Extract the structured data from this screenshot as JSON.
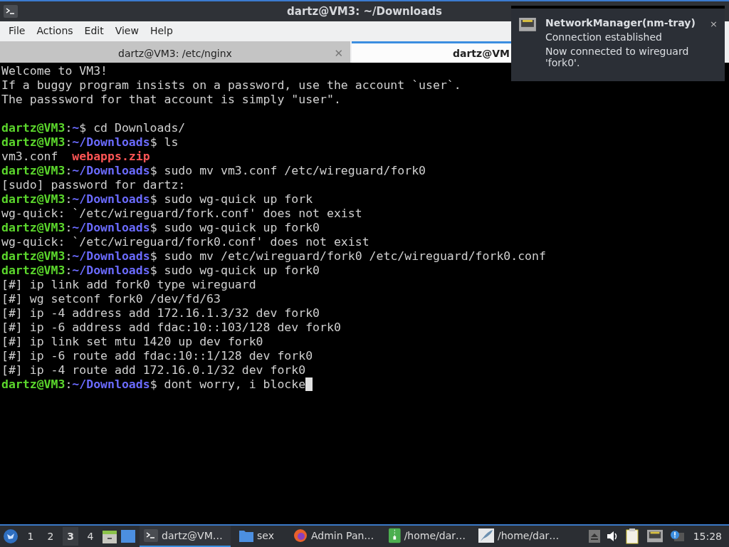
{
  "window": {
    "title": "dartz@VM3: ~/Downloads"
  },
  "menu": [
    "File",
    "Actions",
    "Edit",
    "View",
    "Help"
  ],
  "tabs": [
    {
      "label": "dartz@VM3: /etc/nginx",
      "selected": false,
      "close": "✕"
    },
    {
      "label": "dartz@VM",
      "selected": true
    }
  ],
  "terminal": {
    "lines": [
      {
        "kind": "output",
        "text": "Welcome to VM3!"
      },
      {
        "kind": "output",
        "text": "If a buggy program insists on a password, use the account `user`."
      },
      {
        "kind": "output",
        "text": "The passsword for that account is simply \"user\"."
      },
      {
        "kind": "blank"
      },
      {
        "kind": "prompt",
        "user": "dartz@VM3",
        "sep": ":",
        "path": "~",
        "command": "$ cd Downloads/"
      },
      {
        "kind": "prompt",
        "user": "dartz@VM3",
        "sep": ":",
        "path": "~/Downloads",
        "command": "$ ls"
      },
      {
        "kind": "files",
        "files": [
          {
            "name": "vm3.conf",
            "kind": "plain"
          },
          {
            "name": "webapps.zip",
            "kind": "archive"
          }
        ]
      },
      {
        "kind": "prompt",
        "user": "dartz@VM3",
        "sep": ":",
        "path": "~/Downloads",
        "command": "$ sudo mv vm3.conf /etc/wireguard/fork0"
      },
      {
        "kind": "output",
        "text": "[sudo] password for dartz:"
      },
      {
        "kind": "prompt",
        "user": "dartz@VM3",
        "sep": ":",
        "path": "~/Downloads",
        "command": "$ sudo wg-quick up fork"
      },
      {
        "kind": "output",
        "text": "wg-quick: `/etc/wireguard/fork.conf' does not exist"
      },
      {
        "kind": "prompt",
        "user": "dartz@VM3",
        "sep": ":",
        "path": "~/Downloads",
        "command": "$ sudo wg-quick up fork0"
      },
      {
        "kind": "output",
        "text": "wg-quick: `/etc/wireguard/fork0.conf' does not exist"
      },
      {
        "kind": "prompt",
        "user": "dartz@VM3",
        "sep": ":",
        "path": "~/Downloads",
        "command": "$ sudo mv /etc/wireguard/fork0 /etc/wireguard/fork0.conf"
      },
      {
        "kind": "prompt",
        "user": "dartz@VM3",
        "sep": ":",
        "path": "~/Downloads",
        "command": "$ sudo wg-quick up fork0"
      },
      {
        "kind": "output",
        "text": "[#] ip link add fork0 type wireguard"
      },
      {
        "kind": "output",
        "text": "[#] wg setconf fork0 /dev/fd/63"
      },
      {
        "kind": "output",
        "text": "[#] ip -4 address add 172.16.1.3/32 dev fork0"
      },
      {
        "kind": "output",
        "text": "[#] ip -6 address add fdac:10::103/128 dev fork0"
      },
      {
        "kind": "output",
        "text": "[#] ip link set mtu 1420 up dev fork0"
      },
      {
        "kind": "output",
        "text": "[#] ip -6 route add fdac:10::1/128 dev fork0"
      },
      {
        "kind": "output",
        "text": "[#] ip -4 route add 172.16.0.1/32 dev fork0"
      },
      {
        "kind": "prompt",
        "user": "dartz@VM3",
        "sep": ":",
        "path": "~/Downloads",
        "command": "$ dont worry, i blocke",
        "cursor": true
      }
    ]
  },
  "notification": {
    "title": "NetworkManager(nm-tray)",
    "summary": "Connection established",
    "body": "Now connected to wireguard 'fork0'.",
    "close": "×"
  },
  "taskbar": {
    "desktops": [
      {
        "label": "1",
        "selected": false
      },
      {
        "label": "2",
        "selected": false
      },
      {
        "label": "3",
        "selected": true
      },
      {
        "label": "4",
        "selected": false
      }
    ],
    "tasks": [
      {
        "kind": "terminal",
        "label": "dartz@VM…",
        "selected": true
      },
      {
        "kind": "folder",
        "label": "sex",
        "selected": false
      },
      {
        "kind": "browser",
        "label": "Admin Pan…",
        "selected": false
      },
      {
        "kind": "archive",
        "label": "/home/dar…",
        "selected": false
      },
      {
        "kind": "editor",
        "label": "/home/dar…",
        "selected": false
      }
    ],
    "clock": "15:28"
  }
}
